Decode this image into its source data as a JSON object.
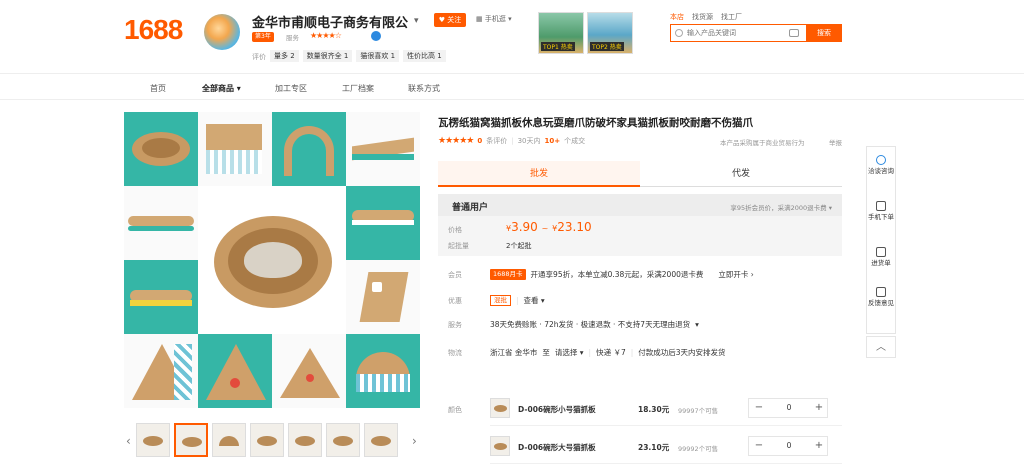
{
  "header": {
    "logo": "1688",
    "shop_name": "金华市甫顺电子商务有限公",
    "follow": "关注",
    "mobile_shop": "手机逛",
    "years_badge": "第3年",
    "service_label": "服务",
    "eval_label": "评价",
    "eval_tags": [
      "量多 2",
      "数量很齐全 1",
      "猫很喜欢 1",
      "性价比高 1"
    ],
    "promo": [
      {
        "label": "TOP1 热卖"
      },
      {
        "label": "TOP2 热卖"
      }
    ],
    "search_tabs": [
      "本店",
      "找货源",
      "找工厂"
    ],
    "search_placeholder": "输入产品关键词",
    "search_button": "搜索",
    "accent_color": "#ff5a00"
  },
  "nav": [
    "首页",
    "全部商品",
    "加工专区",
    "工厂档案",
    "联系方式"
  ],
  "product": {
    "title": "瓦楞纸猫窝猫抓板休息玩耍磨爪防破坏家具猫抓板耐咬耐磨不伤猫爪",
    "rating_stars": "★★★★★",
    "eval_count": "0",
    "eval_suffix": "条评价",
    "sales_period": "30天内",
    "sales_count": "10+",
    "sales_suffix": "个成交",
    "report_text": "本产品采购属于商业贸易行为",
    "report_link": "举报"
  },
  "tabs": [
    "批发",
    "代发"
  ],
  "price_box": {
    "user_type": "普通用户",
    "discount_note": "享95折会员价，采满2000退卡费",
    "price_label": "价格",
    "price_low": "3.90",
    "price_high": "23.10",
    "currency": "¥",
    "range_sep": "~",
    "moq_label": "起批量",
    "moq": "2个起批"
  },
  "info": {
    "member_label": "会员",
    "member_badge": "1688月卡",
    "member_text": "开通享95折，本单立减0.38元起，采满2000退卡费",
    "member_link": "立即开卡",
    "promo_label": "优惠",
    "promo_badge": "混批",
    "promo_link": "查看",
    "service_label": "服务",
    "service_text": "38天免费赊账 · 72h发货 · 极速退款 · 不支持7天无理由退货",
    "logistics_label": "物流",
    "logistics_from": "浙江省 金华市",
    "logistics_to_word": "至",
    "logistics_select": "请选择",
    "logistics_fee": "快递 ￥7",
    "logistics_note": "付款成功后3天内安排发货"
  },
  "sku": {
    "label": "颜色",
    "items": [
      {
        "name": "D-006碗形小号猫抓板",
        "price": "18.30元",
        "stock": "99997个可售",
        "qty": "0"
      },
      {
        "name": "D-006碗形大号猫抓板",
        "price": "23.10元",
        "stock": "99992个可售",
        "qty": "0"
      }
    ]
  },
  "float_bar": [
    "洽谈咨询",
    "手机下单",
    "进货单",
    "反馈意见"
  ]
}
